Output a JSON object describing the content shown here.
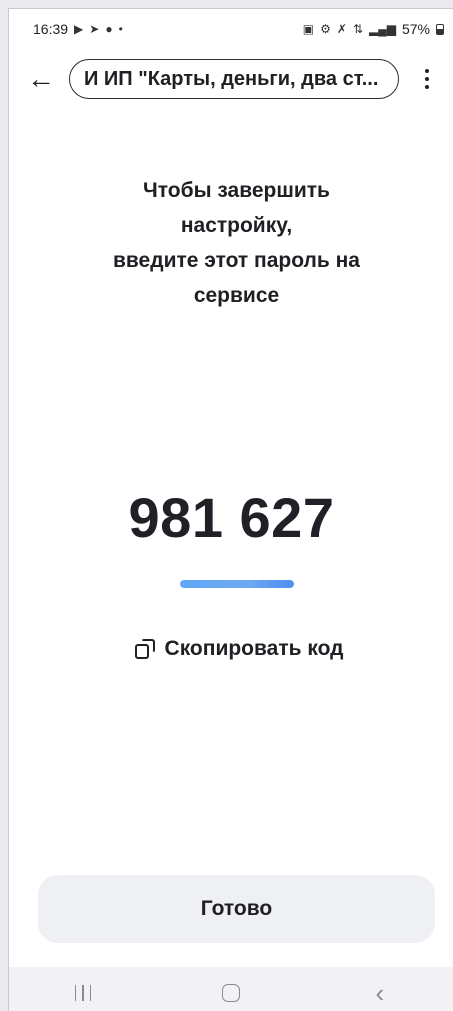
{
  "status_bar": {
    "time": "16:39",
    "left_icons": [
      "video-icon",
      "telegram-icon",
      "chat-icon",
      "dot-icon"
    ],
    "right_icons": [
      "lock-icon",
      "alarm-icon",
      "mute-icon",
      "4g-icon",
      "signal-icon"
    ],
    "battery": "57%"
  },
  "header": {
    "back_icon": "arrow-left-icon",
    "title": "И  ИП \"Карты, деньги, два ст...",
    "menu_icon": "vertical-dots-icon"
  },
  "main": {
    "instruction": "Чтобы завершить\nнастройку,\nвведите этот пароль на\nсервисе",
    "code": "981 627",
    "progress_fraction": 1.0,
    "copy_label": "Скопировать код",
    "copy_icon": "copy-icon"
  },
  "footer": {
    "done_label": "Готово"
  },
  "nav_bar": {
    "recents_icon": "recents-icon",
    "home_icon": "home-icon",
    "back_icon": "back-chevron-icon"
  },
  "colors": {
    "accent_progress": "#5fa8f8",
    "button_bg": "#eef0f4",
    "text": "#1f1f24"
  }
}
